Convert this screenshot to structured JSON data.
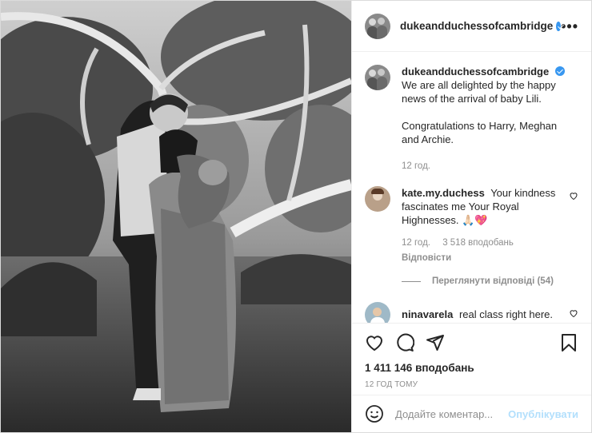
{
  "post": {
    "author": "dukeandduchessofcambridge",
    "more_icon": "•••",
    "caption": {
      "username": "dukeandduchessofcambridge",
      "line1": "We are all delighted by the happy news of the arrival of baby Lili.",
      "line2": "Congratulations to Harry, Meghan and Archie.",
      "time": "12 год."
    },
    "comments": [
      {
        "username": "kate.my.duchess",
        "text": "Your kindness fascinates me Your Royal Highnesses. 🙏🏻💖",
        "time": "12 год.",
        "likes": "3 518 вподобань",
        "reply": "Відповісти"
      },
      {
        "username": "ninavarela",
        "text": "real class right here.",
        "time": "",
        "likes": ""
      }
    ],
    "view_replies": "Переглянути відповіді (54)",
    "likes_count": "1 411 146 вподобань",
    "posted": "12 ГОД ТОМУ",
    "add_comment_placeholder": "Додайте коментар...",
    "publish_label": "Опублікувати"
  },
  "colors": {
    "verified": "#3897f0",
    "muted": "#8e8e8e",
    "publish_disabled": "#b2dffc"
  }
}
